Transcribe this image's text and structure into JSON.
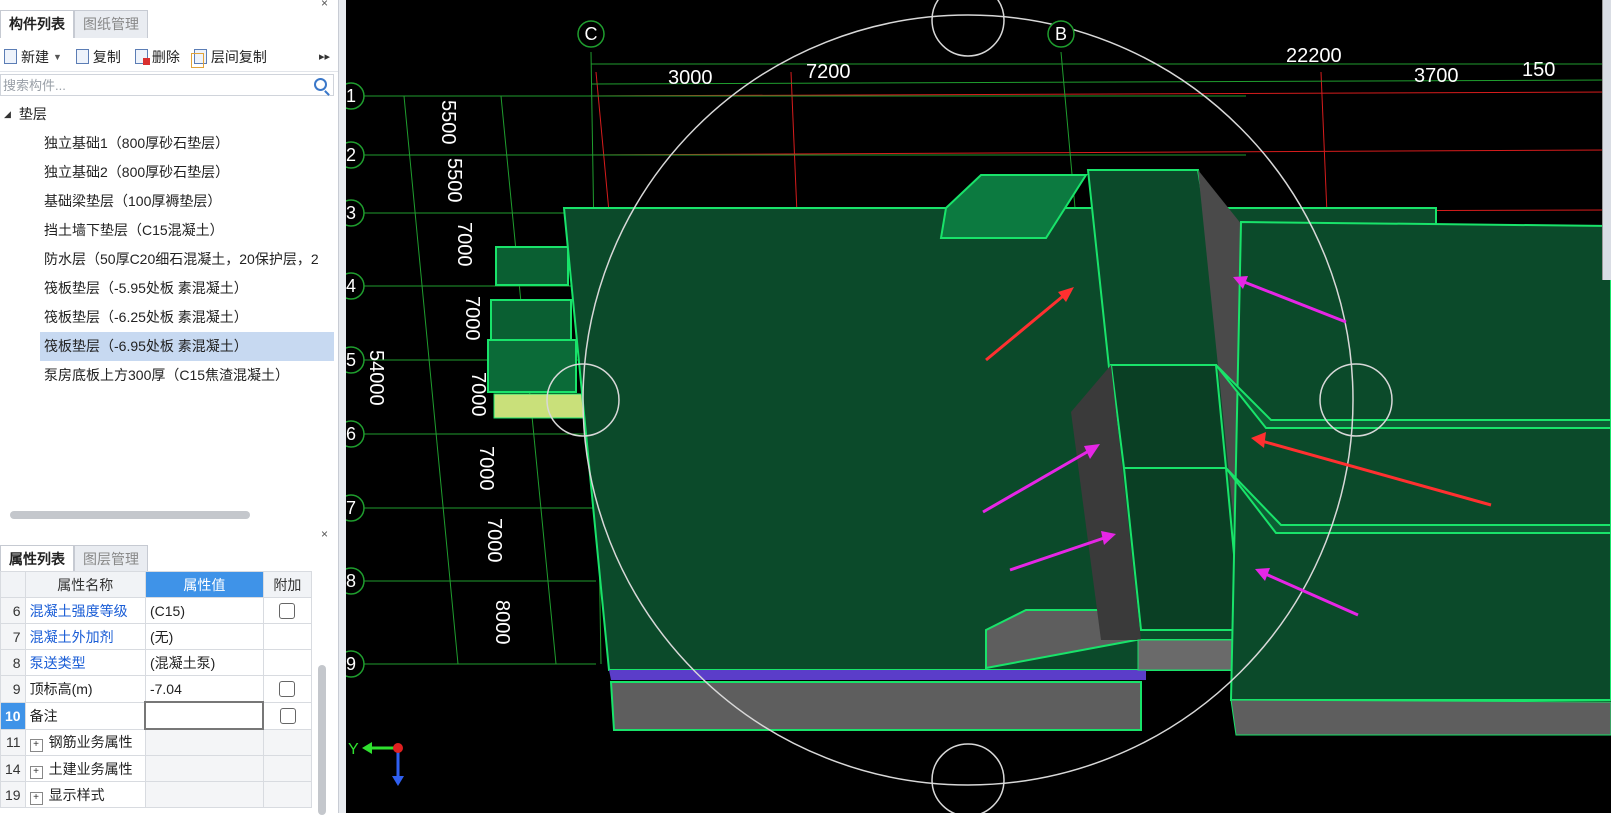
{
  "component_panel": {
    "close": "×",
    "tabs": [
      "构件列表",
      "图纸管理"
    ],
    "toolbar": {
      "new": "新建",
      "copy": "复制",
      "delete": "删除",
      "floor_copy": "层间复制",
      "more": "▸▸"
    },
    "search_placeholder": "搜索构件...",
    "tree_root": "垫层",
    "items": [
      "独立基础1（800厚砂石垫层）",
      "独立基础2（800厚砂石垫层）",
      "基础梁垫层（100厚褥垫层）",
      "挡土墙下垫层（C15混凝土）",
      "防水层（50厚C20细石混凝土，20保护层，2",
      "筏板垫层（-5.95处板 素混凝土）",
      "筏板垫层（-6.25处板 素混凝土）",
      "筏板垫层（-6.95处板 素混凝土）",
      "泵房底板上方300厚（C15焦渣混凝土）"
    ],
    "selected_index": 7
  },
  "property_panel": {
    "close": "×",
    "tabs": [
      "属性列表",
      "图层管理"
    ],
    "headers": [
      "属性名称",
      "属性值",
      "附加"
    ],
    "rows": [
      {
        "idx": "6",
        "name": "混凝土强度等级",
        "value": "(C15)",
        "checkbox": true,
        "blue": true
      },
      {
        "idx": "7",
        "name": "混凝土外加剂",
        "value": "(无)",
        "checkbox": false,
        "blue": true
      },
      {
        "idx": "8",
        "name": "泵送类型",
        "value": "(混凝土泵)",
        "checkbox": false,
        "blue": true
      },
      {
        "idx": "9",
        "name": "顶标高(m)",
        "value": "-7.04",
        "checkbox": true,
        "blue": false
      },
      {
        "idx": "10",
        "name": "备注",
        "value": "",
        "checkbox": true,
        "blue": false
      },
      {
        "idx": "11",
        "name": "钢筋业务属性",
        "value": "",
        "checkbox": false,
        "blue": false,
        "expand": true
      },
      {
        "idx": "14",
        "name": "土建业务属性",
        "value": "",
        "checkbox": false,
        "blue": false,
        "expand": true
      },
      {
        "idx": "19",
        "name": "显示样式",
        "value": "",
        "checkbox": false,
        "blue": false,
        "expand": true
      }
    ]
  },
  "viewport": {
    "axis_labels_columns": [
      "C",
      "B"
    ],
    "axis_labels_rows": [
      "1",
      "2",
      "3",
      "4",
      "5",
      "6",
      "7",
      "8",
      "9"
    ],
    "top_dims": [
      "3000",
      "7200",
      "22200",
      "3700",
      "150"
    ],
    "side_dims": [
      "5500",
      "5500",
      "7000",
      "7000",
      "7000",
      "7000",
      "7000",
      "8000"
    ],
    "total_dim": "54000",
    "axis_indicator": "Y",
    "colors": {
      "slab": "#0b4a2a",
      "edge": "#19e36a",
      "grid_red": "#d61c1c",
      "grid_green": "#1f9d2e",
      "arrow_red": "#ff3030",
      "arrow_magenta": "#e626e6"
    }
  }
}
